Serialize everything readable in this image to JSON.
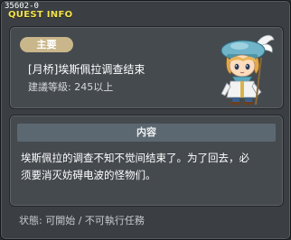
{
  "quest_id": "35602-0",
  "window": {
    "title": "QUEST INFO"
  },
  "quest": {
    "type_badge": "主要",
    "name": "[月桥]埃斯佩拉调查结束",
    "level_requirement": "建議等級: 245以上"
  },
  "content": {
    "header": "内容",
    "description_line1": "埃斯佩拉的调查不知不觉间结束了。为了回去，必",
    "description_line2": "须要消灭妨碍电波的怪物们。"
  },
  "status": "状態: 可開始 / 不可執行任務",
  "colors": {
    "title": "#f2e24a",
    "badge": "#c9b68a",
    "panel": "#454a4f"
  }
}
